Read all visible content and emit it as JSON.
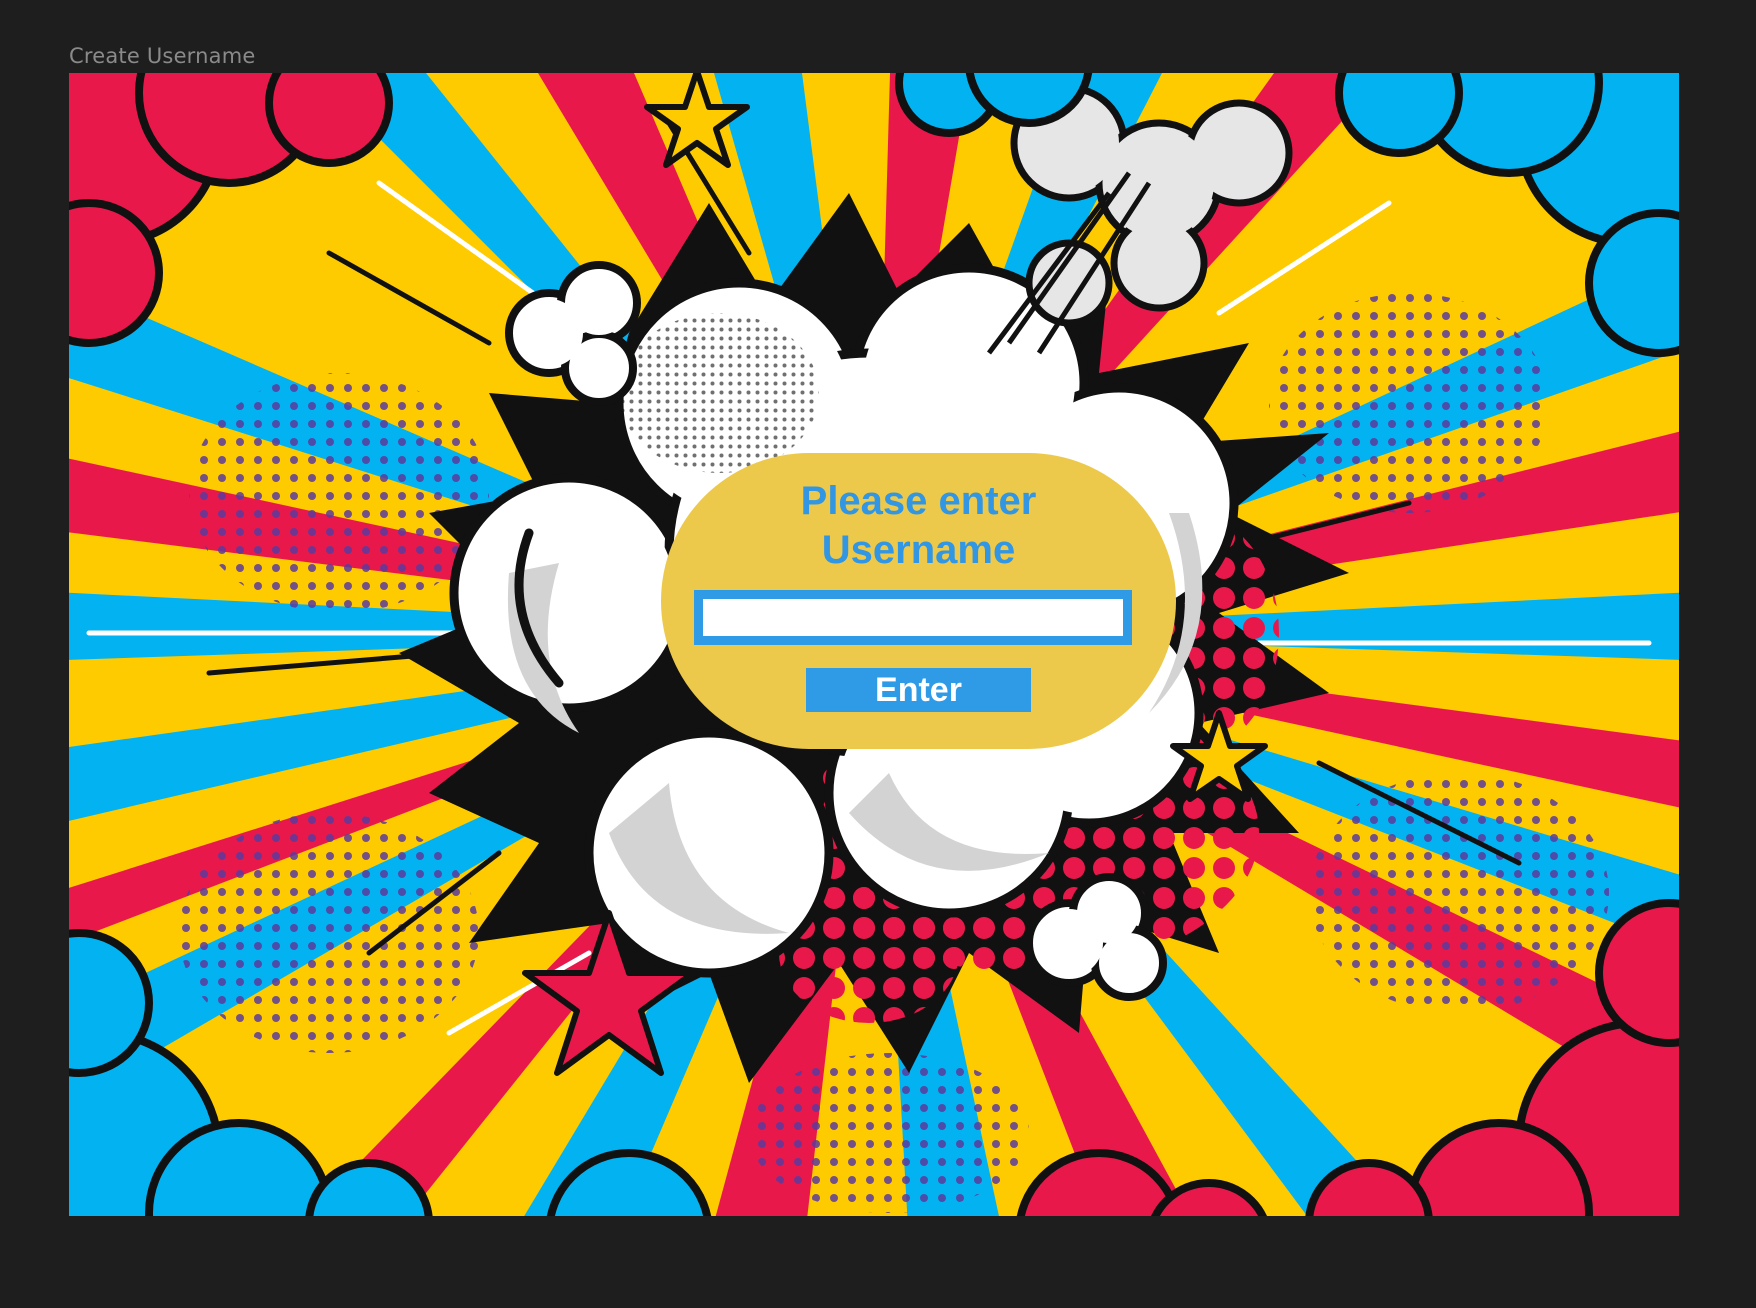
{
  "frame": {
    "label": "Create Username"
  },
  "background": {
    "description_icon": "comic-explosion-background",
    "colors": {
      "red": "#e8194a",
      "blue": "#03b2f0",
      "yellow": "#fecb00",
      "purple_dots": "#5b3a9c",
      "cloud_white": "#ffffff",
      "cloud_shadow": "#d3d3d3",
      "outline": "#111111"
    }
  },
  "dialog": {
    "title": "Please enter\nUsername",
    "input_value": "",
    "input_placeholder": "",
    "button_label": "Enter",
    "colors": {
      "panel": "#ecc94b",
      "accent": "#2f9be7",
      "title": "#3196e3"
    }
  }
}
